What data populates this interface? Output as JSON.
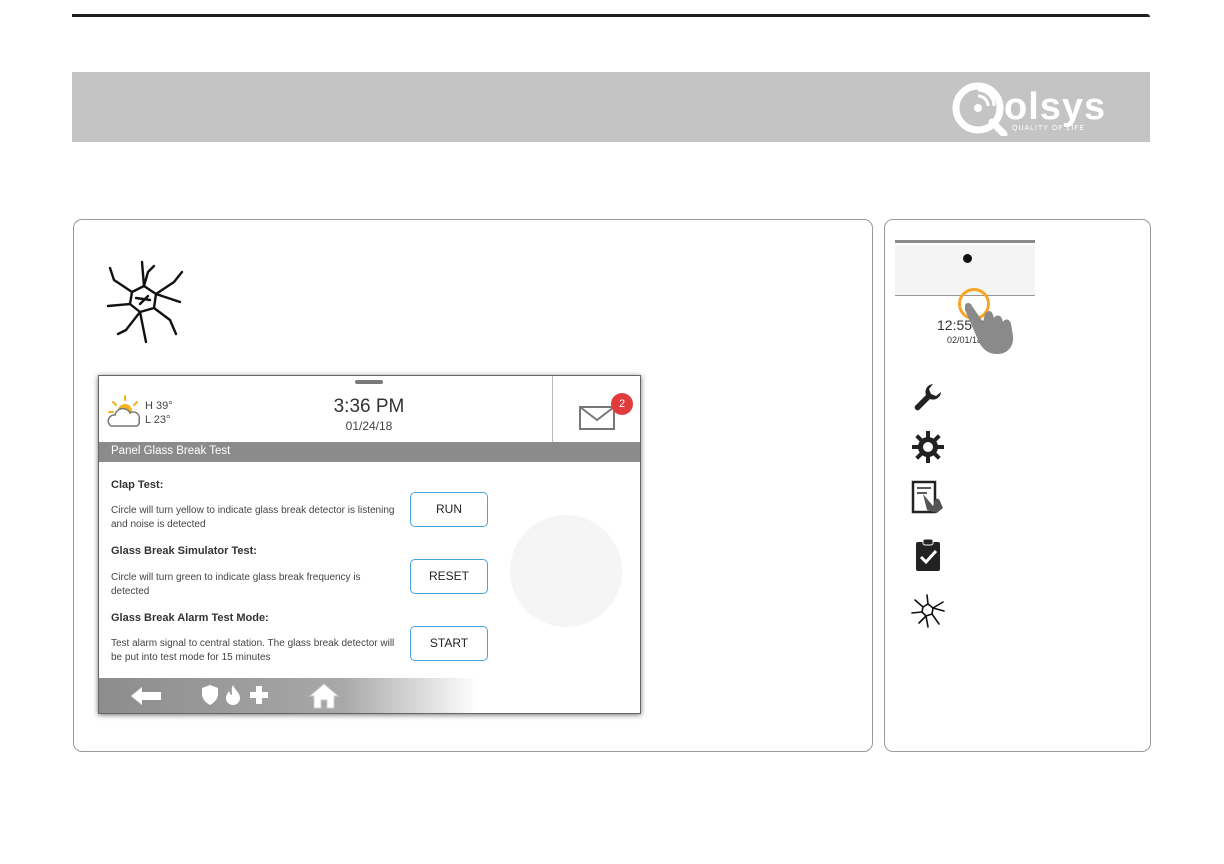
{
  "brand": {
    "logo_text": "olsys",
    "logo_tagline": "QUALITY OF LIFE",
    "colors": {
      "header_band": "#c4c4c4",
      "accent": "#4aa3df",
      "badge": "#e23b3b",
      "ring": "#f5a623"
    }
  },
  "icons": {
    "glass_break": "glass-break-icon",
    "weather": "partly-cloudy-icon",
    "message": "envelope-icon",
    "back": "back-arrow-icon",
    "security": "shield-icon",
    "fire": "flame-icon",
    "medical": "plus-icon",
    "home": "home-icon",
    "tools": "wrench-icon",
    "settings": "gear-icon",
    "sensor_test": "touch-panel-icon",
    "system_tests": "clipboard-check-icon"
  },
  "panel": {
    "weather": {
      "high": "H 39°",
      "low": "L 23°"
    },
    "clock": {
      "time": "3:36 PM",
      "date": "01/24/18"
    },
    "messages": {
      "badge_count": "2"
    },
    "title": "Panel Glass Break Test",
    "tests": [
      {
        "heading": "Clap Test:",
        "description": "Circle will turn yellow to indicate glass break detector is listening and noise is detected",
        "button": "RUN"
      },
      {
        "heading": "Glass Break Simulator Test:",
        "description": "Circle will turn green to indicate glass break frequency is detected",
        "button": "RESET"
      },
      {
        "heading": "Glass Break Alarm Test Mode:",
        "description": "Test alarm signal to central station. The glass break detector will be put into test mode for 15 minutes",
        "button": "START"
      }
    ]
  },
  "side": {
    "time": "12:55 P",
    "date": "02/01/18"
  }
}
